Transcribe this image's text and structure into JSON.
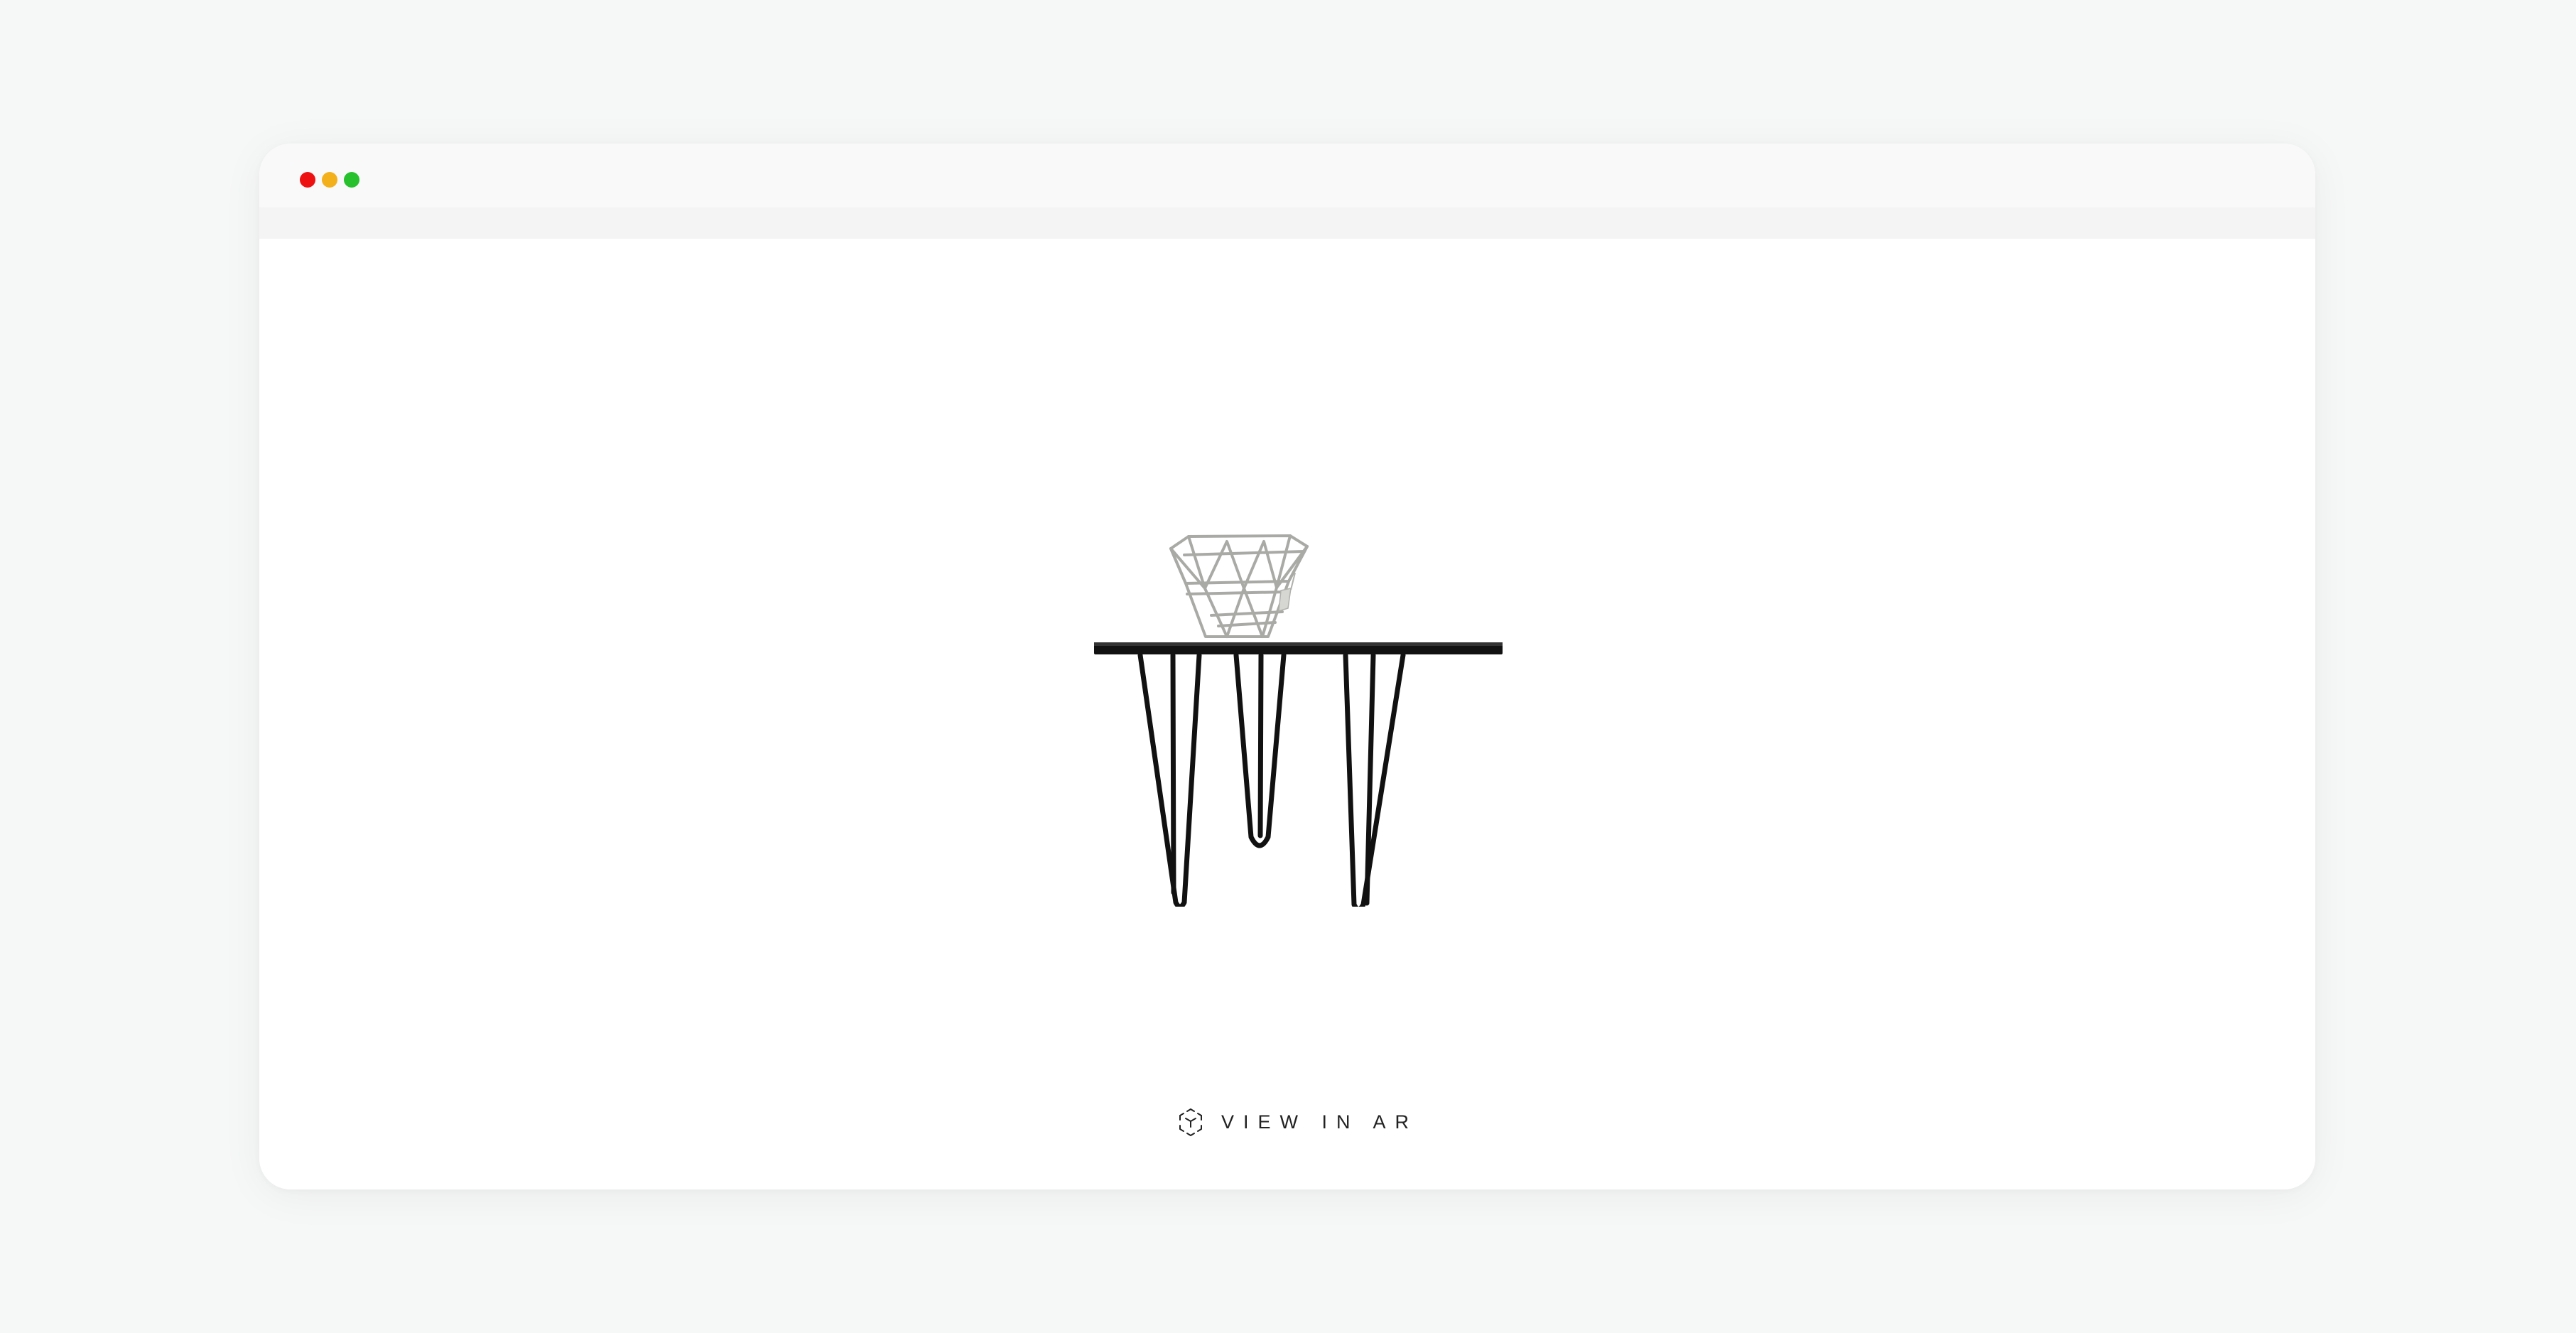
{
  "window": {
    "controls": [
      "close",
      "minimize",
      "maximize"
    ],
    "colors": {
      "close": "#ee1111",
      "minimize": "#f3b01b",
      "maximize": "#27c12d"
    }
  },
  "viewer": {
    "product_icon": "side-table-with-wire-basket",
    "ar_button": {
      "icon": "ar-cube-icon",
      "label": "VIEW IN AR"
    }
  }
}
